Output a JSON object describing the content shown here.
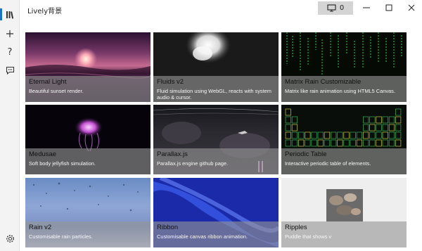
{
  "window": {
    "title": "Lively背景",
    "monitor_count": "0",
    "controls": [
      "minimize-icon",
      "maximize-icon",
      "close-icon"
    ]
  },
  "rail": {
    "items": [
      {
        "name": "library-icon",
        "glyph": "▥",
        "selected": true
      },
      {
        "name": "add-icon",
        "glyph": "+"
      },
      {
        "name": "help-icon",
        "glyph": "?"
      },
      {
        "name": "feedback-icon",
        "glyph": "⋯"
      }
    ],
    "settings_glyph": "⚙",
    "accent": "#1a73c8"
  },
  "wallpapers": [
    {
      "title": "Eternal Light",
      "desc": "Beautiful sunset render."
    },
    {
      "title": "Fluids v2",
      "desc": "Fluid simulation using WebGL, reacts with system audio & cursor."
    },
    {
      "title": "Matrix Rain Customizable",
      "desc": "Matrix like rain animation using HTML5 Canvas."
    },
    {
      "title": "Medusae",
      "desc": "Soft body jellyfish simulation."
    },
    {
      "title": "Parallax.js",
      "desc": "Parallax.js engine github page."
    },
    {
      "title": "Periodic Table",
      "desc": "Interactive periodic table of elements."
    },
    {
      "title": "Rain v2",
      "desc": "Customisable rain particles."
    },
    {
      "title": "Ribbon",
      "desc": "Customisable canvas ribbon animation."
    },
    {
      "title": "Ripples",
      "desc": "Puddle that shows v"
    }
  ]
}
